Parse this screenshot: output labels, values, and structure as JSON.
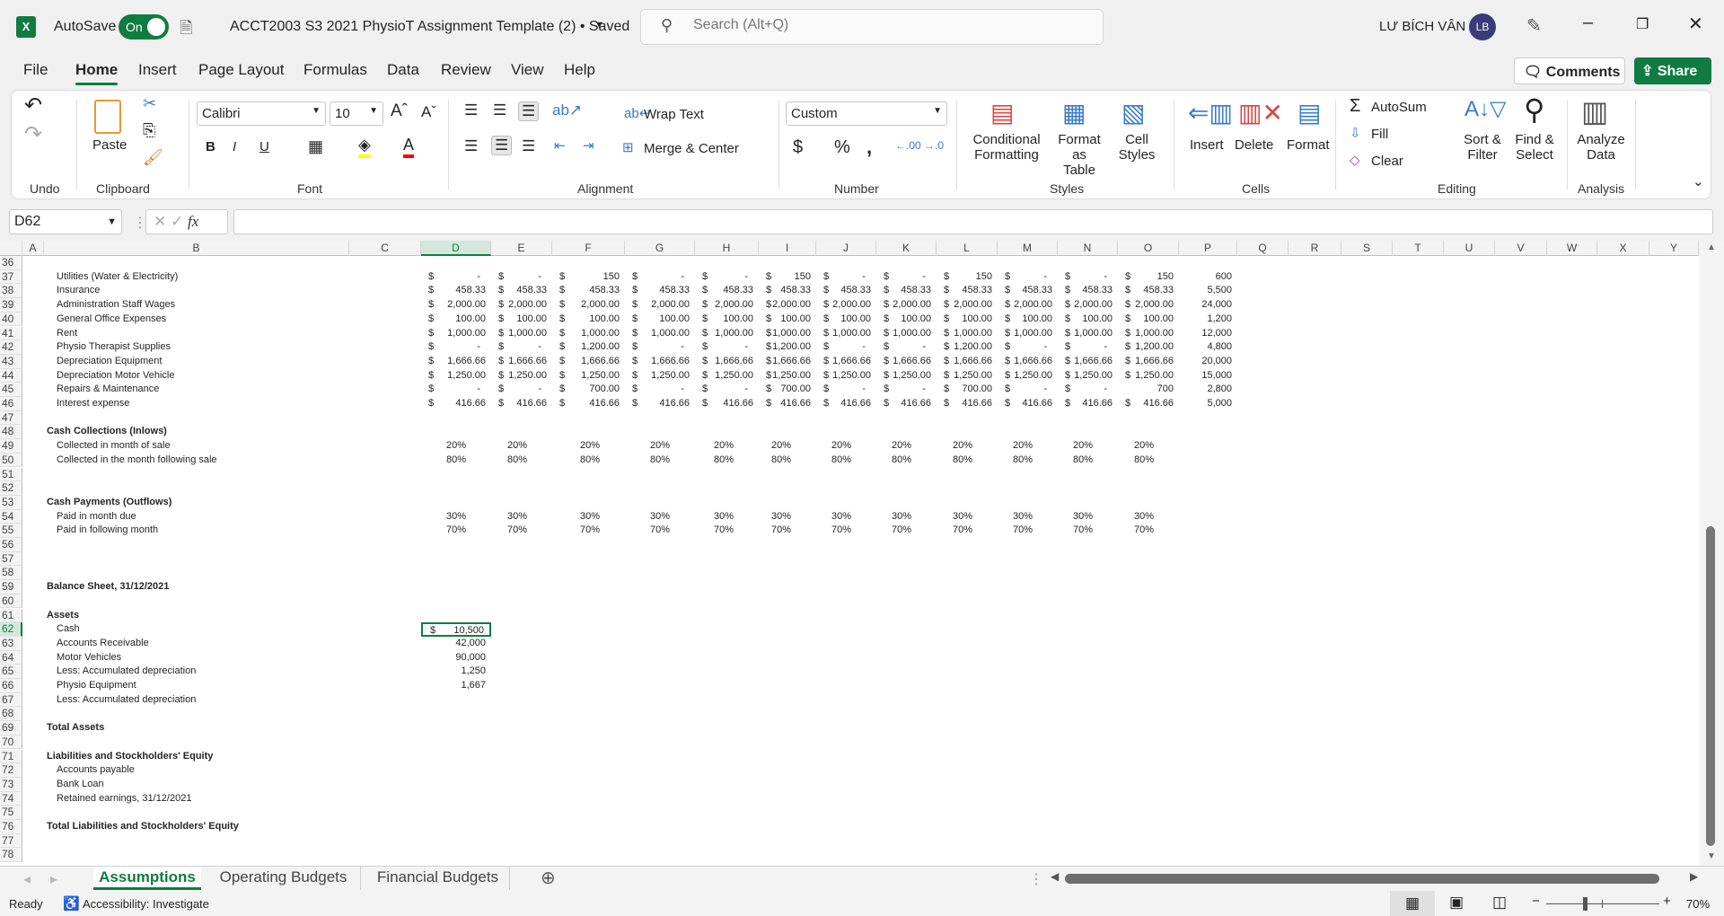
{
  "titlebar": {
    "app_icon": "excel-icon",
    "autosave_label": "AutoSave",
    "autosave_state": "On",
    "doc_title": "ACCT2003 S3 2021 PhysioT Assignment Template (2) • Saved",
    "search_placeholder": "Search (Alt+Q)",
    "user_name": "LƯ BÍCH VÂN",
    "user_initials": "LB"
  },
  "menu": {
    "tabs": [
      "File",
      "Home",
      "Insert",
      "Page Layout",
      "Formulas",
      "Data",
      "Review",
      "View",
      "Help"
    ],
    "active": "Home",
    "comments": "Comments",
    "share": "Share"
  },
  "ribbon": {
    "groups": [
      "Undo",
      "Clipboard",
      "Font",
      "Alignment",
      "Number",
      "Styles",
      "Cells",
      "Editing",
      "Analysis"
    ],
    "paste": "Paste",
    "font_name": "Calibri",
    "font_size": "10",
    "wrap_text": "Wrap Text",
    "merge_center": "Merge & Center",
    "number_format": "Custom",
    "conditional_formatting": [
      "Conditional",
      "Formatting"
    ],
    "format_as_table": [
      "Format as",
      "Table"
    ],
    "cell_styles": [
      "Cell",
      "Styles"
    ],
    "insert": "Insert",
    "delete": "Delete",
    "format": "Format",
    "autosum": "AutoSum",
    "fill": "Fill",
    "clear": "Clear",
    "sort_filter": [
      "Sort &",
      "Filter"
    ],
    "find_select": [
      "Find &",
      "Select"
    ],
    "analyze_data": [
      "Analyze",
      "Data"
    ]
  },
  "formula_bar": {
    "name_box": "D62",
    "formula": ""
  },
  "sheet": {
    "columns": [
      "A",
      "B",
      "C",
      "D",
      "E",
      "F",
      "G",
      "H",
      "I",
      "J",
      "K",
      "L",
      "M",
      "N",
      "O",
      "P",
      "Q",
      "R",
      "S",
      "T",
      "U",
      "V",
      "W",
      "X",
      "Y"
    ],
    "selected_cell": "D62",
    "first_row": 36,
    "last_row": 78,
    "month_columns": [
      "D",
      "E",
      "F",
      "G",
      "H",
      "I",
      "J",
      "K",
      "L",
      "M",
      "N",
      "O"
    ],
    "rows": [
      {
        "n": 37,
        "label": "Utilities (Water & Electricity)",
        "values": [
          "$ -",
          "$ -",
          "$ 150",
          "$ -",
          "$ -",
          "$ 150",
          "$ -",
          "$ -",
          "$ 150",
          "$ -",
          "$ -",
          "$ 150"
        ],
        "total": "600"
      },
      {
        "n": 38,
        "label": "Insurance",
        "values": [
          "$ 458.33",
          "$ 458.33",
          "$ 458.33",
          "$ 458.33",
          "$ 458.33",
          "$ 458.33",
          "$ 458.33",
          "$ 458.33",
          "$ 458.33",
          "$ 458.33",
          "$ 458.33",
          "$ 458.33"
        ],
        "total": "5,500"
      },
      {
        "n": 39,
        "label": "Administration Staff Wages",
        "values": [
          "$ 2,000.00",
          "$ 2,000.00",
          "$ 2,000.00",
          "$ 2,000.00",
          "$ 2,000.00",
          "$ 2,000.00",
          "$ 2,000.00",
          "$ 2,000.00",
          "$ 2,000.00",
          "$ 2,000.00",
          "$ 2,000.00",
          "$ 2,000.00"
        ],
        "total": "24,000"
      },
      {
        "n": 40,
        "label": "General Office Expenses",
        "values": [
          "$ 100.00",
          "$ 100.00",
          "$ 100.00",
          "$ 100.00",
          "$ 100.00",
          "$ 100.00",
          "$ 100.00",
          "$ 100.00",
          "$ 100.00",
          "$ 100.00",
          "$ 100.00",
          "$ 100.00"
        ],
        "total": "1,200"
      },
      {
        "n": 41,
        "label": "Rent",
        "values": [
          "$ 1,000.00",
          "$ 1,000.00",
          "$ 1,000.00",
          "$ 1,000.00",
          "$ 1,000.00",
          "$ 1,000.00",
          "$ 1,000.00",
          "$ 1,000.00",
          "$ 1,000.00",
          "$ 1,000.00",
          "$ 1,000.00",
          "$ 1,000.00"
        ],
        "total": "12,000"
      },
      {
        "n": 42,
        "label": "Physio Therapist Supplies",
        "values": [
          "$ -",
          "$ -",
          "$ 1,200.00",
          "$ -",
          "$ -",
          "$ 1,200.00",
          "$ -",
          "$ -",
          "$ 1,200.00",
          "$ -",
          "$ -",
          "$ 1,200.00"
        ],
        "total": "4,800"
      },
      {
        "n": 43,
        "label": "Depreciation Equipment",
        "values": [
          "$ 1,666.66",
          "$ 1,666.66",
          "$ 1,666.66",
          "$ 1,666.66",
          "$ 1,666.66",
          "$ 1,666.66",
          "$ 1,666.66",
          "$ 1,666.66",
          "$ 1,666.66",
          "$ 1,666.66",
          "$ 1,666.66",
          "$ 1,666.66"
        ],
        "total": "20,000"
      },
      {
        "n": 44,
        "label": "Depreciation Motor Vehicle",
        "values": [
          "$ 1,250.00",
          "$ 1,250.00",
          "$ 1,250.00",
          "$ 1,250.00",
          "$ 1,250.00",
          "$ 1,250.00",
          "$ 1,250.00",
          "$ 1,250.00",
          "$ 1,250.00",
          "$ 1,250.00",
          "$ 1,250.00",
          "$ 1,250.00"
        ],
        "total": "15,000"
      },
      {
        "n": 45,
        "label": "Repairs & Maintenance",
        "values": [
          "$ -",
          "$ -",
          "$ 700.00",
          "$ -",
          "$ -",
          "$ 700.00",
          "$ -",
          "$ -",
          "$ 700.00",
          "$ -",
          "$ -",
          "700"
        ],
        "total": "2,800"
      },
      {
        "n": 46,
        "label": "Interest expense",
        "values": [
          "$ 416.66",
          "$ 416.66",
          "$ 416.66",
          "$ 416.66",
          "$ 416.66",
          "$ 416.66",
          "$ 416.66",
          "$ 416.66",
          "$ 416.66",
          "$ 416.66",
          "$ 416.66",
          "$ 416.66"
        ],
        "total": "5,000"
      },
      {
        "n": 48,
        "label": "Cash Collections (Inlows)",
        "bold": true
      },
      {
        "n": 49,
        "label": "Collected in month of sale",
        "values": [
          "20%",
          "20%",
          "20%",
          "20%",
          "20%",
          "20%",
          "20%",
          "20%",
          "20%",
          "20%",
          "20%",
          "20%"
        ]
      },
      {
        "n": 50,
        "label": "Collected in the month following sale",
        "values": [
          "80%",
          "80%",
          "80%",
          "80%",
          "80%",
          "80%",
          "80%",
          "80%",
          "80%",
          "80%",
          "80%",
          "80%"
        ]
      },
      {
        "n": 53,
        "label": "Cash Payments (Outflows)",
        "bold": true
      },
      {
        "n": 54,
        "label": "Paid in month due",
        "values": [
          "30%",
          "30%",
          "30%",
          "30%",
          "30%",
          "30%",
          "30%",
          "30%",
          "30%",
          "30%",
          "30%",
          "30%"
        ]
      },
      {
        "n": 55,
        "label": "Paid in following month",
        "values": [
          "70%",
          "70%",
          "70%",
          "70%",
          "70%",
          "70%",
          "70%",
          "70%",
          "70%",
          "70%",
          "70%",
          "70%"
        ]
      },
      {
        "n": 59,
        "label": "Balance Sheet, 31/12/2021",
        "bold": true
      },
      {
        "n": 61,
        "label": "Assets",
        "bold": true
      },
      {
        "n": 62,
        "label": "Cash",
        "values": [
          "$ 10,500"
        ]
      },
      {
        "n": 63,
        "label": "Accounts Receivable",
        "values": [
          "42,000"
        ]
      },
      {
        "n": 64,
        "label": "Motor Vehicles",
        "values": [
          "90,000"
        ]
      },
      {
        "n": 65,
        "label": "Less: Accumulated depreciation",
        "values": [
          "1,250"
        ]
      },
      {
        "n": 66,
        "label": "Physio Equipment",
        "values": [
          "1,667"
        ]
      },
      {
        "n": 67,
        "label": "Less: Accumulated depreciation"
      },
      {
        "n": 69,
        "label": "Total Assets",
        "bold": true
      },
      {
        "n": 71,
        "label": "Liabilities and Stockholders' Equity",
        "bold": true
      },
      {
        "n": 72,
        "label": "Accounts payable"
      },
      {
        "n": 73,
        "label": "Bank Loan"
      },
      {
        "n": 74,
        "label": "Retained earnings, 31/12/2021"
      },
      {
        "n": 76,
        "label": "Total Liabilities and Stockholders' Equity",
        "bold": true
      }
    ]
  },
  "sheet_tabs": {
    "tabs": [
      "Assumptions",
      "Operating Budgets",
      "Financial Budgets"
    ],
    "active": "Assumptions"
  },
  "status": {
    "ready": "Ready",
    "accessibility": "Accessibility: Investigate",
    "zoom": "70%",
    "zoom_percent": 70
  },
  "colors": {
    "accent": "#107c41",
    "avatar": "#3b3a7a"
  }
}
